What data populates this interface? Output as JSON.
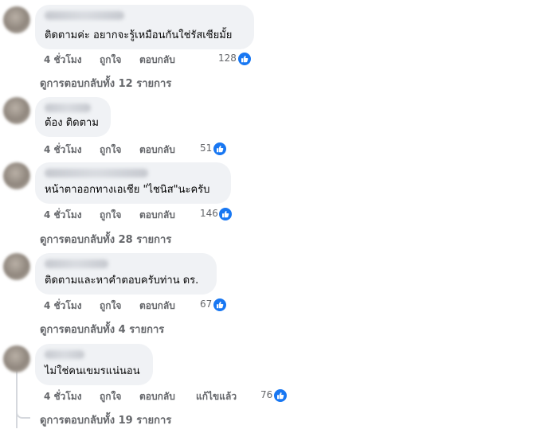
{
  "comments": [
    {
      "text": "ติดตามค่ะ อยากจะรู้เหมือนกันใช่รัสเซียมั้ย",
      "time": "4 ชั่วโมง",
      "like": "ถูกใจ",
      "reply": "ตอบกลับ",
      "edited": "",
      "reactions": "128",
      "replies": "ดูการตอบกลับทั้ง 12 รายการ"
    },
    {
      "text": "ต้อง ติดตาม",
      "time": "4 ชั่วโมง",
      "like": "ถูกใจ",
      "reply": "ตอบกลับ",
      "edited": "",
      "reactions": "51",
      "replies": ""
    },
    {
      "text": "หน้าตาออกทางเอเชีย \"ไชนิส\"นะครับ",
      "time": "4 ชั่วโมง",
      "like": "ถูกใจ",
      "reply": "ตอบกลับ",
      "edited": "",
      "reactions": "146",
      "replies": "ดูการตอบกลับทั้ง 28 รายการ"
    },
    {
      "text": "ติดตามและหาคำตอบครับท่าน ดร.",
      "time": "4 ชั่วโมง",
      "like": "ถูกใจ",
      "reply": "ตอบกลับ",
      "edited": "",
      "reactions": "67",
      "replies": "ดูการตอบกลับทั้ง 4 รายการ"
    },
    {
      "text": "ไม่ใช่คนเขมรแน่นอน",
      "time": "4 ชั่วโมง",
      "like": "ถูกใจ",
      "reply": "ตอบกลับ",
      "edited": "แก้ไขแล้ว",
      "reactions": "76",
      "replies": "ดูการตอบกลับทั้ง 19 รายการ"
    }
  ],
  "icons": {
    "reaction": "like-thumbs-up-icon"
  },
  "colors": {
    "like_blue": "#1877f2",
    "bubble": "#f0f2f5",
    "meta": "#65676b"
  }
}
